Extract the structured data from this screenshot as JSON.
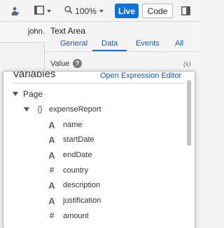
{
  "toolbar": {
    "zoom_value": "100%",
    "live_label": "Live",
    "code_label": "Code",
    "icons": [
      "people-icon",
      "frame-icon",
      "zoom-icon",
      "panel-toggle-icon"
    ]
  },
  "canvas": {
    "user_name": "john."
  },
  "properties": {
    "title": "Text Area",
    "tabs": [
      {
        "label": "General"
      },
      {
        "label": "Data"
      },
      {
        "label": "Events"
      },
      {
        "label": "All"
      }
    ],
    "active_tab": "Data",
    "value_label": "Value",
    "help_glyph": "?",
    "fx_glyph": "(x)"
  },
  "variables": {
    "title": "Variables",
    "link": "Open Expression Editor",
    "tree": {
      "root": {
        "label": "Page"
      },
      "object": {
        "label": "expenseReport",
        "glyph": "{}"
      },
      "fields": [
        {
          "label": "name",
          "type": "text",
          "glyph": "A"
        },
        {
          "label": "startDate",
          "type": "text",
          "glyph": "A"
        },
        {
          "label": "endDate",
          "type": "text",
          "glyph": "A"
        },
        {
          "label": "country",
          "type": "number",
          "glyph": "#"
        },
        {
          "label": "description",
          "type": "text",
          "glyph": "A"
        },
        {
          "label": "justification",
          "type": "text",
          "glyph": "A"
        },
        {
          "label": "amount",
          "type": "number",
          "glyph": "#"
        }
      ]
    }
  },
  "colors": {
    "accent": "#1270d6",
    "link": "#1a5aa6"
  }
}
